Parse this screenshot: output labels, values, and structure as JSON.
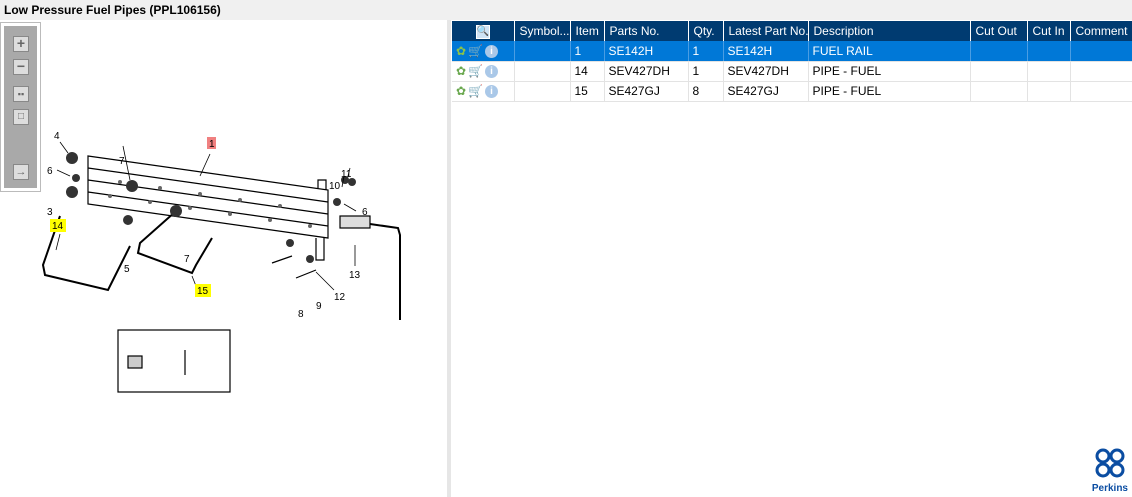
{
  "title": "Low Pressure Fuel Pipes (PPL106156)",
  "toolbar": {
    "zoom_in": "+",
    "zoom_out": "−"
  },
  "diagram": {
    "callouts": {
      "c1": "1",
      "c3": "3",
      "c4": "4",
      "c5": "5",
      "c6a": "6",
      "c6b": "6",
      "c7a": "7",
      "c7b": "7",
      "c8": "8",
      "c9": "9",
      "c10": "10",
      "c11": "11",
      "c12": "12",
      "c13": "13",
      "c14": "14",
      "c15": "15"
    },
    "highlight_selected": "#f08080",
    "highlight_other": "#ffff00"
  },
  "table": {
    "headers": [
      "Symbol...",
      "Item",
      "Parts No.",
      "Qty.",
      "Latest Part No.",
      "Description",
      "Cut Out",
      "Cut In",
      "Comment"
    ],
    "rows": [
      {
        "symbol": "",
        "item": "1",
        "part": "SE142H",
        "qty": "1",
        "latest": "SE142H",
        "desc": "FUEL RAIL",
        "cutout": "",
        "cutin": "",
        "comment": "",
        "selected": true
      },
      {
        "symbol": "",
        "item": "14",
        "part": "SEV427DH",
        "qty": "1",
        "latest": "SEV427DH",
        "desc": "PIPE - FUEL",
        "cutout": "",
        "cutin": "",
        "comment": ""
      },
      {
        "symbol": "",
        "item": "15",
        "part": "SE427GJ",
        "qty": "8",
        "latest": "SE427GJ",
        "desc": "PIPE - FUEL",
        "cutout": "",
        "cutin": "",
        "comment": ""
      }
    ]
  },
  "logo": {
    "text": "Perkins"
  },
  "colors": {
    "header": "#003b71",
    "selected": "#0078d7"
  }
}
